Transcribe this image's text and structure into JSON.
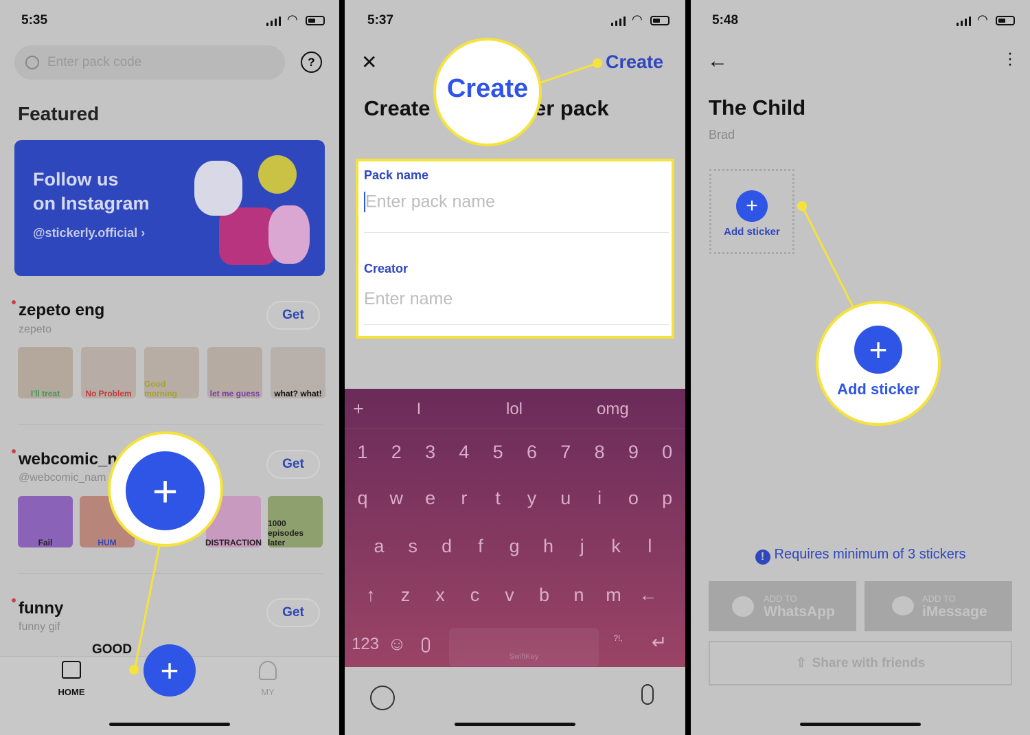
{
  "colors": {
    "accent": "#2f55e6",
    "highlight": "#f5e33c",
    "link": "#2f47b5",
    "keyboard": "#8b3a64"
  },
  "panel1": {
    "time": "5:35",
    "search_placeholder": "Enter pack code",
    "help_icon": "?",
    "featured_label": "Featured",
    "banner": {
      "line1": "Follow us",
      "line2": "on Instagram",
      "handle": "@stickerly.official ›"
    },
    "packs": [
      {
        "title": "zepeto eng",
        "sub": "zepeto",
        "get": "Get",
        "stickers": [
          "I'll treat",
          "No Problem",
          "Good morning",
          "let me guess",
          "what? what!"
        ]
      },
      {
        "title": "webcomic_n",
        "sub": "@webcomic_nam",
        "get": "Get",
        "stickers": [
          "Fail",
          "HUM",
          "",
          "DISTRACTION",
          "1000 episodes later"
        ]
      },
      {
        "title": "funny",
        "sub": "funny gif",
        "get": "Get",
        "stickers": [
          "GOOD"
        ]
      }
    ],
    "nav": {
      "home": "HOME",
      "add": "+",
      "my": "MY"
    },
    "callout_plus": "+"
  },
  "panel2": {
    "time": "5:37",
    "close": "✕",
    "create": "Create",
    "callout_text": "Create",
    "title_left": "Create",
    "title_right": "er pack",
    "pack_name_label": "Pack name",
    "pack_name_placeholder": "Enter pack name",
    "creator_label": "Creator",
    "creator_placeholder": "Enter name",
    "suggestions": [
      "+",
      "I",
      "lol",
      "omg"
    ],
    "rows": [
      [
        "1",
        "2",
        "3",
        "4",
        "5",
        "6",
        "7",
        "8",
        "9",
        "0"
      ],
      [
        "q",
        "w",
        "e",
        "r",
        "t",
        "y",
        "u",
        "i",
        "o",
        "p"
      ],
      [
        "a",
        "s",
        "d",
        "f",
        "g",
        "h",
        "j",
        "k",
        "l"
      ],
      [
        "↑",
        "z",
        "x",
        "c",
        "v",
        "b",
        "n",
        "m",
        "←"
      ]
    ],
    "bottom": {
      "numbers": "123",
      "emoji": "☺",
      "punct": "?!,",
      "enter": "↵",
      "brand": "SwiftKey"
    }
  },
  "panel3": {
    "time": "5:48",
    "title": "The Child",
    "creator": "Brad",
    "add_sticker": "Add sticker",
    "callout_add_sticker": "Add sticker",
    "warning": "Requires minimum of 3 stickers",
    "whatsapp": {
      "small": "ADD TO",
      "big": "WhatsApp"
    },
    "imessage": {
      "small": "ADD TO",
      "big": "iMessage"
    },
    "share": "Share with friends"
  }
}
